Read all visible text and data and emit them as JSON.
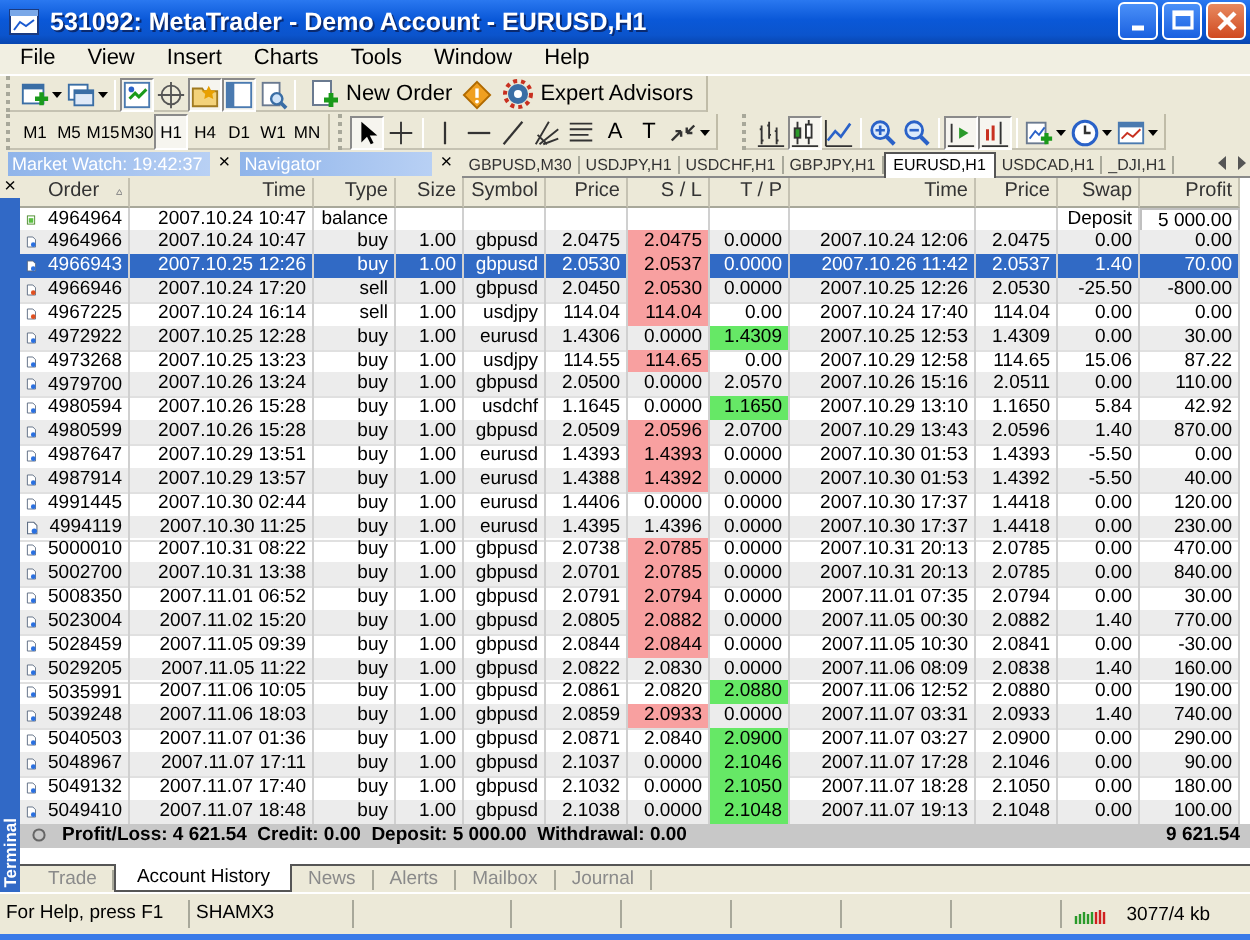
{
  "window": {
    "title": "531092: MetaTrader - Demo Account - EURUSD,H1"
  },
  "menu": [
    "File",
    "View",
    "Insert",
    "Charts",
    "Tools",
    "Window",
    "Help"
  ],
  "standard_toolbar": [
    {
      "kind": "new-chart",
      "dropdown": true,
      "selected": false
    },
    {
      "kind": "profiles",
      "dropdown": true,
      "selected": false
    },
    {
      "kind": "separator"
    },
    {
      "kind": "market-watch",
      "selected": true
    },
    {
      "kind": "data-window",
      "selected": false
    },
    {
      "kind": "navigator",
      "selected": true
    },
    {
      "kind": "terminal",
      "selected": true
    },
    {
      "kind": "tester",
      "selected": false
    },
    {
      "kind": "separator"
    },
    {
      "kind": "new-order",
      "label": "New Order",
      "selected": false
    },
    {
      "kind": "warning",
      "selected": false
    },
    {
      "kind": "expert-advisors",
      "label": "Expert Advisors",
      "selected": false
    }
  ],
  "timeframes": [
    {
      "label": "M1",
      "selected": false
    },
    {
      "label": "M5",
      "selected": false
    },
    {
      "label": "M15",
      "selected": false
    },
    {
      "label": "M30",
      "selected": false
    },
    {
      "label": "H1",
      "selected": true
    },
    {
      "label": "H4",
      "selected": false
    },
    {
      "label": "D1",
      "selected": false
    },
    {
      "label": "W1",
      "selected": false
    },
    {
      "label": "MN",
      "selected": false
    }
  ],
  "drawing_toolbar": [
    {
      "kind": "cursor",
      "selected": true
    },
    {
      "kind": "crosshair",
      "selected": false
    },
    {
      "kind": "separator"
    },
    {
      "kind": "vertical-line",
      "selected": false
    },
    {
      "kind": "horizontal-line",
      "selected": false
    },
    {
      "kind": "trend-line",
      "selected": false
    },
    {
      "kind": "fan",
      "selected": false
    },
    {
      "kind": "stacked-lines",
      "selected": false
    },
    {
      "kind": "text",
      "label": "A",
      "selected": false
    },
    {
      "kind": "text-box",
      "label": "T",
      "selected": false
    },
    {
      "kind": "arrows",
      "dropdown": true,
      "selected": false
    }
  ],
  "chart_toolbar": [
    {
      "kind": "bars",
      "selected": false
    },
    {
      "kind": "candles",
      "selected": true
    },
    {
      "kind": "line",
      "selected": false
    },
    {
      "kind": "separator"
    },
    {
      "kind": "zoom-in",
      "selected": false
    },
    {
      "kind": "zoom-out",
      "selected": false
    },
    {
      "kind": "separator"
    },
    {
      "kind": "auto-scroll",
      "selected": true
    },
    {
      "kind": "chart-shift",
      "selected": true
    },
    {
      "kind": "separator"
    },
    {
      "kind": "indicators",
      "dropdown": true,
      "selected": false
    },
    {
      "kind": "periods",
      "dropdown": true,
      "selected": false
    },
    {
      "kind": "templates",
      "dropdown": true,
      "selected": false
    }
  ],
  "panels": [
    {
      "title": "Market Watch: 19:42:37",
      "close": "×"
    },
    {
      "title": "Navigator",
      "close": "×"
    }
  ],
  "chart_tabs": [
    {
      "label": "GBPUSD,M30",
      "selected": false
    },
    {
      "label": "USDJPY,H1",
      "selected": false
    },
    {
      "label": "USDCHF,H1",
      "selected": false
    },
    {
      "label": "GBPJPY,H1",
      "selected": false
    },
    {
      "label": "EURUSD,H1",
      "selected": true
    },
    {
      "label": "USDCAD,H1",
      "selected": false
    },
    {
      "label": "_DJI,H1",
      "selected": false
    }
  ],
  "terminal": {
    "title": "Terminal",
    "close": "×",
    "columns": [
      "Order",
      "Time",
      "Type",
      "Size",
      "Symbol",
      "Price",
      "S / L",
      "T / P",
      "Time",
      "Price",
      "Swap",
      "Profit"
    ],
    "rows": [
      {
        "kind": "balance",
        "selected": false,
        "order": "4964964",
        "time": "2007.10.24 10:47",
        "type": "balance",
        "swap": "Deposit",
        "profit": "5 000.00"
      },
      {
        "kind": "buy",
        "selected": false,
        "order": "4964966",
        "time": "2007.10.24 10:47",
        "type": "buy",
        "size": "1.00",
        "symbol": "gbpusd",
        "price": "2.0475",
        "sl": "2.0475",
        "sl_hit": true,
        "tp": "0.0000",
        "tp_hit": false,
        "close_time": "2007.10.24 12:06",
        "close_price": "2.0475",
        "swap": "0.00",
        "profit": "0.00"
      },
      {
        "kind": "buy",
        "selected": true,
        "order": "4966943",
        "time": "2007.10.25 12:26",
        "type": "buy",
        "size": "1.00",
        "symbol": "gbpusd",
        "price": "2.0530",
        "sl": "2.0537",
        "sl_hit": true,
        "tp": "0.0000",
        "tp_hit": false,
        "close_time": "2007.10.26 11:42",
        "close_price": "2.0537",
        "swap": "1.40",
        "profit": "70.00"
      },
      {
        "kind": "sell",
        "selected": false,
        "order": "4966946",
        "time": "2007.10.24 17:20",
        "type": "sell",
        "size": "1.00",
        "symbol": "gbpusd",
        "price": "2.0450",
        "sl": "2.0530",
        "sl_hit": true,
        "tp": "0.0000",
        "tp_hit": false,
        "close_time": "2007.10.25 12:26",
        "close_price": "2.0530",
        "swap": "-25.50",
        "profit": "-800.00"
      },
      {
        "kind": "sell",
        "selected": false,
        "order": "4967225",
        "time": "2007.10.24 16:14",
        "type": "sell",
        "size": "1.00",
        "symbol": "usdjpy",
        "price": "114.04",
        "sl": "114.04",
        "sl_hit": true,
        "tp": "0.00",
        "tp_hit": false,
        "close_time": "2007.10.24 17:40",
        "close_price": "114.04",
        "swap": "0.00",
        "profit": "0.00"
      },
      {
        "kind": "buy",
        "selected": false,
        "order": "4972922",
        "time": "2007.10.25 12:28",
        "type": "buy",
        "size": "1.00",
        "symbol": "eurusd",
        "price": "1.4306",
        "sl": "0.0000",
        "sl_hit": false,
        "tp": "1.4309",
        "tp_hit": true,
        "close_time": "2007.10.25 12:53",
        "close_price": "1.4309",
        "swap": "0.00",
        "profit": "30.00"
      },
      {
        "kind": "buy",
        "selected": false,
        "order": "4973268",
        "time": "2007.10.25 13:23",
        "type": "buy",
        "size": "1.00",
        "symbol": "usdjpy",
        "price": "114.55",
        "sl": "114.65",
        "sl_hit": true,
        "tp": "0.00",
        "tp_hit": false,
        "close_time": "2007.10.29 12:58",
        "close_price": "114.65",
        "swap": "15.06",
        "profit": "87.22"
      },
      {
        "kind": "buy",
        "selected": false,
        "order": "4979700",
        "time": "2007.10.26 13:24",
        "type": "buy",
        "size": "1.00",
        "symbol": "gbpusd",
        "price": "2.0500",
        "sl": "0.0000",
        "sl_hit": false,
        "tp": "2.0570",
        "tp_hit": false,
        "close_time": "2007.10.26 15:16",
        "close_price": "2.0511",
        "swap": "0.00",
        "profit": "110.00"
      },
      {
        "kind": "buy",
        "selected": false,
        "order": "4980594",
        "time": "2007.10.26 15:28",
        "type": "buy",
        "size": "1.00",
        "symbol": "usdchf",
        "price": "1.1645",
        "sl": "0.0000",
        "sl_hit": false,
        "tp": "1.1650",
        "tp_hit": true,
        "close_time": "2007.10.29 13:10",
        "close_price": "1.1650",
        "swap": "5.84",
        "profit": "42.92"
      },
      {
        "kind": "buy",
        "selected": false,
        "order": "4980599",
        "time": "2007.10.26 15:28",
        "type": "buy",
        "size": "1.00",
        "symbol": "gbpusd",
        "price": "2.0509",
        "sl": "2.0596",
        "sl_hit": true,
        "tp": "2.0700",
        "tp_hit": false,
        "close_time": "2007.10.29 13:43",
        "close_price": "2.0596",
        "swap": "1.40",
        "profit": "870.00"
      },
      {
        "kind": "buy",
        "selected": false,
        "order": "4987647",
        "time": "2007.10.29 13:51",
        "type": "buy",
        "size": "1.00",
        "symbol": "eurusd",
        "price": "1.4393",
        "sl": "1.4393",
        "sl_hit": true,
        "tp": "0.0000",
        "tp_hit": false,
        "close_time": "2007.10.30 01:53",
        "close_price": "1.4393",
        "swap": "-5.50",
        "profit": "0.00"
      },
      {
        "kind": "buy",
        "selected": false,
        "order": "4987914",
        "time": "2007.10.29 13:57",
        "type": "buy",
        "size": "1.00",
        "symbol": "eurusd",
        "price": "1.4388",
        "sl": "1.4392",
        "sl_hit": true,
        "tp": "0.0000",
        "tp_hit": false,
        "close_time": "2007.10.30 01:53",
        "close_price": "1.4392",
        "swap": "-5.50",
        "profit": "40.00"
      },
      {
        "kind": "buy",
        "selected": false,
        "order": "4991445",
        "time": "2007.10.30 02:44",
        "type": "buy",
        "size": "1.00",
        "symbol": "eurusd",
        "price": "1.4406",
        "sl": "0.0000",
        "sl_hit": false,
        "tp": "0.0000",
        "tp_hit": false,
        "close_time": "2007.10.30 17:37",
        "close_price": "1.4418",
        "swap": "0.00",
        "profit": "120.00"
      },
      {
        "kind": "buy",
        "selected": false,
        "order": "4994119",
        "time": "2007.10.30 11:25",
        "type": "buy",
        "size": "1.00",
        "symbol": "eurusd",
        "price": "1.4395",
        "sl": "1.4396",
        "sl_hit": false,
        "tp": "0.0000",
        "tp_hit": false,
        "close_time": "2007.10.30 17:37",
        "close_price": "1.4418",
        "swap": "0.00",
        "profit": "230.00"
      },
      {
        "kind": "buy",
        "selected": false,
        "order": "5000010",
        "time": "2007.10.31 08:22",
        "type": "buy",
        "size": "1.00",
        "symbol": "gbpusd",
        "price": "2.0738",
        "sl": "2.0785",
        "sl_hit": true,
        "tp": "0.0000",
        "tp_hit": false,
        "close_time": "2007.10.31 20:13",
        "close_price": "2.0785",
        "swap": "0.00",
        "profit": "470.00"
      },
      {
        "kind": "buy",
        "selected": false,
        "order": "5002700",
        "time": "2007.10.31 13:38",
        "type": "buy",
        "size": "1.00",
        "symbol": "gbpusd",
        "price": "2.0701",
        "sl": "2.0785",
        "sl_hit": true,
        "tp": "0.0000",
        "tp_hit": false,
        "close_time": "2007.10.31 20:13",
        "close_price": "2.0785",
        "swap": "0.00",
        "profit": "840.00"
      },
      {
        "kind": "buy",
        "selected": false,
        "order": "5008350",
        "time": "2007.11.01 06:52",
        "type": "buy",
        "size": "1.00",
        "symbol": "gbpusd",
        "price": "2.0791",
        "sl": "2.0794",
        "sl_hit": true,
        "tp": "0.0000",
        "tp_hit": false,
        "close_time": "2007.11.01 07:35",
        "close_price": "2.0794",
        "swap": "0.00",
        "profit": "30.00"
      },
      {
        "kind": "buy",
        "selected": false,
        "order": "5023004",
        "time": "2007.11.02 15:20",
        "type": "buy",
        "size": "1.00",
        "symbol": "gbpusd",
        "price": "2.0805",
        "sl": "2.0882",
        "sl_hit": true,
        "tp": "0.0000",
        "tp_hit": false,
        "close_time": "2007.11.05 00:30",
        "close_price": "2.0882",
        "swap": "1.40",
        "profit": "770.00"
      },
      {
        "kind": "buy",
        "selected": false,
        "order": "5028459",
        "time": "2007.11.05 09:39",
        "type": "buy",
        "size": "1.00",
        "symbol": "gbpusd",
        "price": "2.0844",
        "sl": "2.0844",
        "sl_hit": true,
        "tp": "0.0000",
        "tp_hit": false,
        "close_time": "2007.11.05 10:30",
        "close_price": "2.0841",
        "swap": "0.00",
        "profit": "-30.00"
      },
      {
        "kind": "buy",
        "selected": false,
        "order": "5029205",
        "time": "2007.11.05 11:22",
        "type": "buy",
        "size": "1.00",
        "symbol": "gbpusd",
        "price": "2.0822",
        "sl": "2.0830",
        "sl_hit": false,
        "tp": "0.0000",
        "tp_hit": false,
        "close_time": "2007.11.06 08:09",
        "close_price": "2.0838",
        "swap": "1.40",
        "profit": "160.00"
      },
      {
        "kind": "buy",
        "selected": false,
        "order": "5035991",
        "time": "2007.11.06 10:05",
        "type": "buy",
        "size": "1.00",
        "symbol": "gbpusd",
        "price": "2.0861",
        "sl": "2.0820",
        "sl_hit": false,
        "tp": "2.0880",
        "tp_hit": true,
        "close_time": "2007.11.06 12:52",
        "close_price": "2.0880",
        "swap": "0.00",
        "profit": "190.00"
      },
      {
        "kind": "buy",
        "selected": false,
        "order": "5039248",
        "time": "2007.11.06 18:03",
        "type": "buy",
        "size": "1.00",
        "symbol": "gbpusd",
        "price": "2.0859",
        "sl": "2.0933",
        "sl_hit": true,
        "tp": "0.0000",
        "tp_hit": false,
        "close_time": "2007.11.07 03:31",
        "close_price": "2.0933",
        "swap": "1.40",
        "profit": "740.00"
      },
      {
        "kind": "buy",
        "selected": false,
        "order": "5040503",
        "time": "2007.11.07 01:36",
        "type": "buy",
        "size": "1.00",
        "symbol": "gbpusd",
        "price": "2.0871",
        "sl": "2.0840",
        "sl_hit": false,
        "tp": "2.0900",
        "tp_hit": true,
        "close_time": "2007.11.07 03:27",
        "close_price": "2.0900",
        "swap": "0.00",
        "profit": "290.00"
      },
      {
        "kind": "buy",
        "selected": false,
        "order": "5048967",
        "time": "2007.11.07 17:11",
        "type": "buy",
        "size": "1.00",
        "symbol": "gbpusd",
        "price": "2.1037",
        "sl": "0.0000",
        "sl_hit": false,
        "tp": "2.1046",
        "tp_hit": true,
        "close_time": "2007.11.07 17:28",
        "close_price": "2.1046",
        "swap": "0.00",
        "profit": "90.00"
      },
      {
        "kind": "buy",
        "selected": false,
        "order": "5049132",
        "time": "2007.11.07 17:40",
        "type": "buy",
        "size": "1.00",
        "symbol": "gbpusd",
        "price": "2.1032",
        "sl": "0.0000",
        "sl_hit": false,
        "tp": "2.1050",
        "tp_hit": true,
        "close_time": "2007.11.07 18:28",
        "close_price": "2.1050",
        "swap": "0.00",
        "profit": "180.00"
      },
      {
        "kind": "buy",
        "selected": false,
        "order": "5049410",
        "time": "2007.11.07 18:48",
        "type": "buy",
        "size": "1.00",
        "symbol": "gbpusd",
        "price": "2.1038",
        "sl": "0.0000",
        "sl_hit": false,
        "tp": "2.1048",
        "tp_hit": true,
        "close_time": "2007.11.07 19:13",
        "close_price": "2.1048",
        "swap": "0.00",
        "profit": "100.00"
      }
    ],
    "summary": {
      "text": "Profit/Loss: 4 621.54  Credit: 0.00  Deposit: 5 000.00  Withdrawal: 0.00",
      "total": "9 621.54"
    },
    "tabs": [
      {
        "label": "Trade",
        "selected": false
      },
      {
        "label": "Account History",
        "selected": true
      },
      {
        "label": "News",
        "selected": false
      },
      {
        "label": "Alerts",
        "selected": false
      },
      {
        "label": "Mailbox",
        "selected": false
      },
      {
        "label": "Journal",
        "selected": false
      }
    ]
  },
  "status_bar": {
    "help": "For Help, press F1",
    "profile": "SHAMX3",
    "traffic": "3077/4 kb"
  }
}
